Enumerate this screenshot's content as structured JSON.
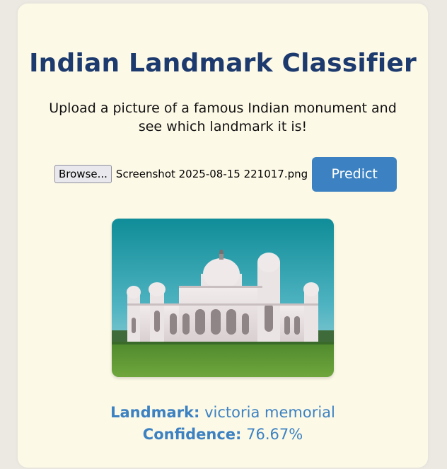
{
  "header": {
    "title": "Indian Landmark Classifier",
    "subtitle": "Upload a picture of a famous Indian monument and see which landmark it is!"
  },
  "upload": {
    "browse_label": "Browse...",
    "file_name": "Screenshot 2025-08-15 221017.png",
    "predict_label": "Predict"
  },
  "image": {
    "subject": "Victoria Memorial photograph"
  },
  "result": {
    "landmark_label": "Landmark:",
    "landmark_value": "victoria memorial",
    "confidence_label": "Confidence:",
    "confidence_value": "76.67%"
  },
  "colors": {
    "background": "#ebe9e2",
    "card": "#fdf9e7",
    "title": "#1c3a6e",
    "accent": "#3c82c2"
  }
}
